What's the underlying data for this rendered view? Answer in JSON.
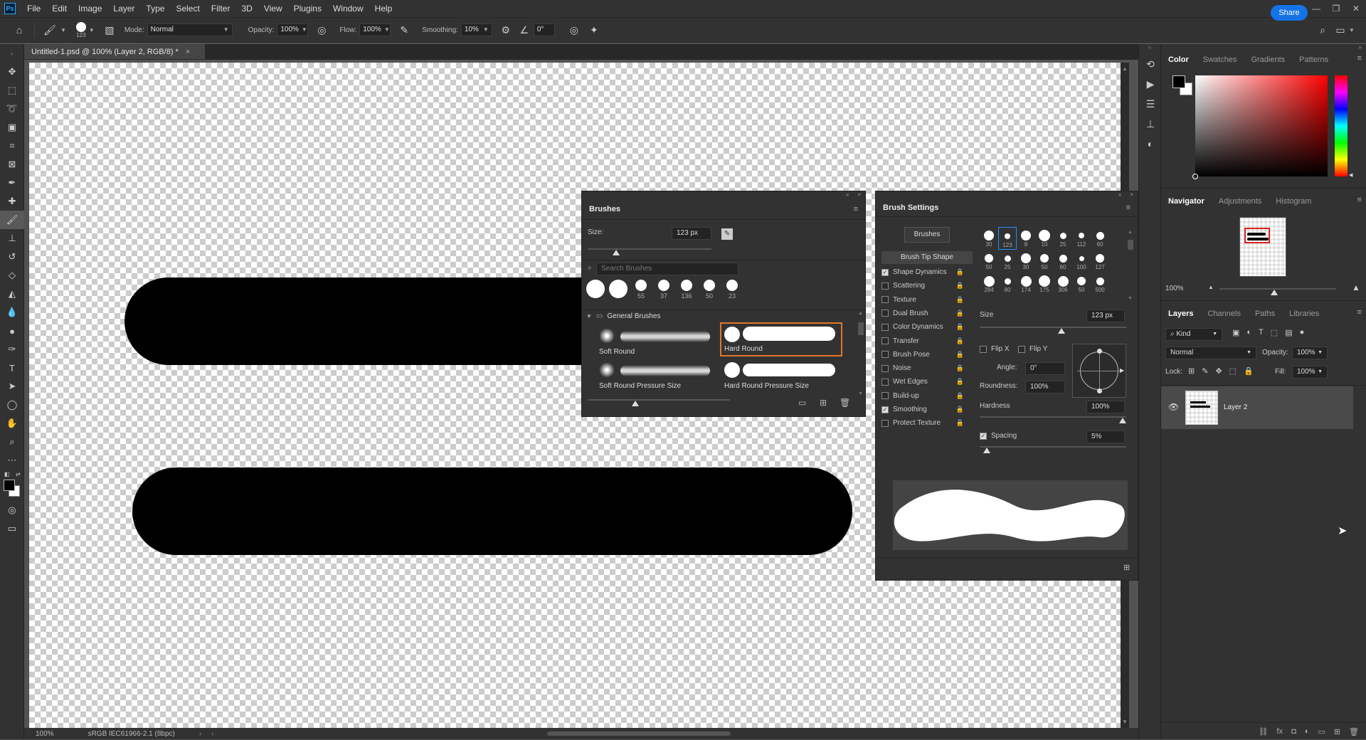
{
  "menu": [
    "File",
    "Edit",
    "Image",
    "Layer",
    "Type",
    "Select",
    "Filter",
    "3D",
    "View",
    "Plugins",
    "Window",
    "Help"
  ],
  "logo": "Ps",
  "options": {
    "brush_size": "123",
    "mode_label": "Mode:",
    "mode_value": "Normal",
    "opacity_label": "Opacity:",
    "opacity_value": "100%",
    "flow_label": "Flow:",
    "flow_value": "100%",
    "smoothing_label": "Smoothing:",
    "smoothing_value": "10%",
    "angle_value": "0°",
    "share_label": "Share"
  },
  "document": {
    "tab_title": "Untitled-1.psd @ 100% (Layer 2, RGB/8) *",
    "zoom": "100%",
    "profile": "sRGB IEC61966-2.1 (8bpc)"
  },
  "brushes_panel": {
    "title": "Brushes",
    "size_label": "Size:",
    "size_value": "123 px",
    "size_level_percent": 23,
    "search_placeholder": "Search Brushes",
    "recent_sizes": [
      "55",
      "37",
      "136",
      "50",
      "23"
    ],
    "group": "General Brushes",
    "brushes": [
      {
        "name": "Soft Round"
      },
      {
        "name": "Hard Round"
      },
      {
        "name": "Soft Round Pressure Size"
      },
      {
        "name": "Hard Round Pressure Size"
      }
    ]
  },
  "brush_settings": {
    "title": "Brush Settings",
    "brushes_button": "Brushes",
    "brush_tip_shape": "Brush Tip Shape",
    "options": [
      {
        "label": "Shape Dynamics",
        "checked": true
      },
      {
        "label": "Scattering",
        "checked": false
      },
      {
        "label": "Texture",
        "checked": false
      },
      {
        "label": "Dual Brush",
        "checked": false
      },
      {
        "label": "Color Dynamics",
        "checked": false
      },
      {
        "label": "Transfer",
        "checked": false
      },
      {
        "label": "Brush Pose",
        "checked": false
      },
      {
        "label": "Noise",
        "checked": false
      },
      {
        "label": "Wet Edges",
        "checked": false
      },
      {
        "label": "Build-up",
        "checked": false
      },
      {
        "label": "Smoothing",
        "checked": true
      },
      {
        "label": "Protect Texture",
        "checked": false
      }
    ],
    "tip_sizes": [
      "30",
      "123",
      "8",
      "10",
      "25",
      "112",
      "60",
      "50",
      "25",
      "30",
      "50",
      "60",
      "100",
      "127",
      "284",
      "80",
      "174",
      "175",
      "306",
      "50",
      "500"
    ],
    "size_label": "Size",
    "size_value": "123 px",
    "flip_x": "Flip X",
    "flip_y": "Flip Y",
    "angle_label": "Angle:",
    "angle_value": "0°",
    "roundness_label": "Roundness:",
    "roundness_value": "100%",
    "hardness_label": "Hardness",
    "hardness_value": "100%",
    "spacing_label": "Spacing",
    "spacing_value": "5%"
  },
  "color_panel": {
    "tabs": [
      "Color",
      "Swatches",
      "Gradients",
      "Patterns"
    ],
    "foreground": "#000000",
    "background": "#ffffff",
    "hue": "#ff0000"
  },
  "navigator_panel": {
    "tabs": [
      "Navigator",
      "Adjustments",
      "Histogram"
    ],
    "zoom": "100%"
  },
  "layers_panel": {
    "tabs": [
      "Layers",
      "Channels",
      "Paths",
      "Libraries"
    ],
    "kind_label": "Kind",
    "blend_mode": "Normal",
    "opacity_label": "Opacity:",
    "opacity_value": "100%",
    "lock_label": "Lock:",
    "fill_label": "Fill:",
    "fill_value": "100%",
    "layers": [
      {
        "name": "Layer 2",
        "visible": true
      }
    ]
  }
}
